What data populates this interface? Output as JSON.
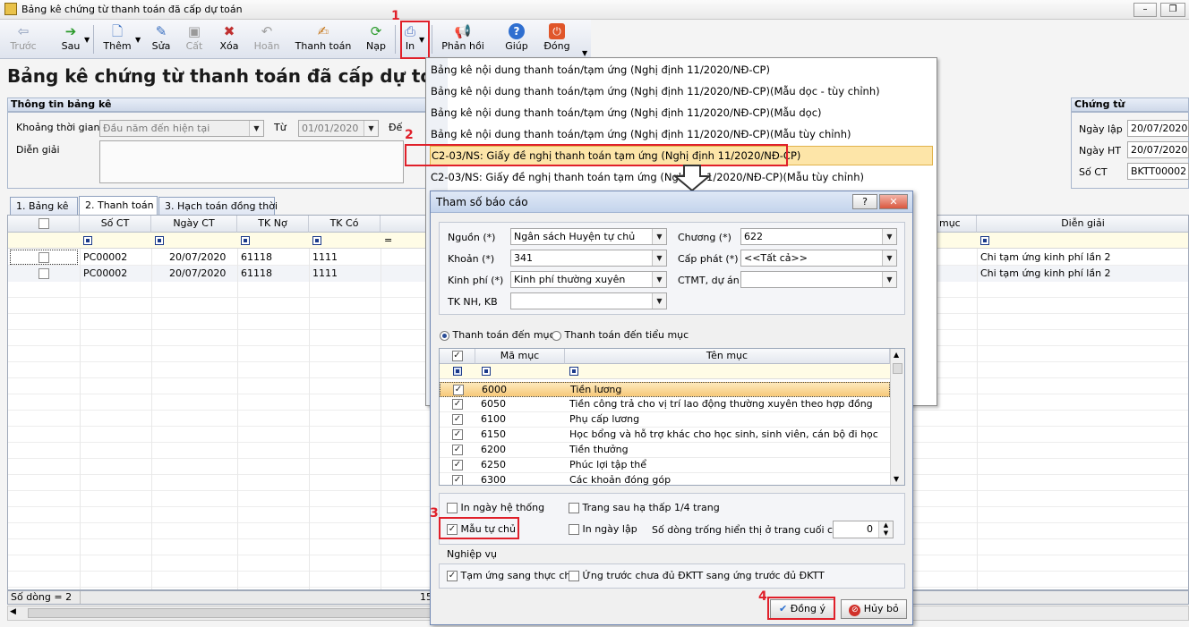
{
  "window": {
    "title": "Bảng kê chứng từ thanh toán đã cấp dự toán"
  },
  "toolbar": {
    "prev": "Trước",
    "next": "Sau",
    "add": "Thêm",
    "edit": "Sửa",
    "save": "Cất",
    "delete": "Xóa",
    "undo": "Hoãn",
    "pay": "Thanh toán",
    "load": "Nạp",
    "print": "In",
    "feedback": "Phản hồi",
    "help": "Giúp",
    "close": "Đóng"
  },
  "steps": {
    "s1": "1",
    "s2": "2",
    "s3": "3",
    "s4": "4"
  },
  "page": {
    "title": "Bảng kê chứng từ thanh toán đã cấp dự to"
  },
  "info": {
    "header": "Thông tin bảng kê",
    "period_label": "Khoảng thời gian",
    "period_value": "Đầu năm đến hiện tại",
    "from_label": "Từ",
    "from_value": "01/01/2020",
    "to_label": "Đế",
    "desc_label": "Diễn giải"
  },
  "voucher": {
    "header": "Chứng từ",
    "date_label": "Ngày lập",
    "date_value": "20/07/2020",
    "ht_label": "Ngày HT",
    "ht_value": "20/07/2020",
    "no_label": "Số CT",
    "no_value": "BKTT00002"
  },
  "tabs": [
    "1. Bảng kê",
    "2. Thanh toán",
    "3. Hạch toán đồng thời"
  ],
  "grid": {
    "cols": {
      "so_ct": "Số CT",
      "ngay_ct": "Ngày CT",
      "tk_no": "TK Nợ",
      "tk_co": "TK Có",
      "muc": "mục",
      "dien_giai": "Diễn giải"
    },
    "filter_eq": "=",
    "rows": [
      {
        "so_ct": "PC00002",
        "ngay_ct": "20/07/2020",
        "tk_no": "61118",
        "tk_co": "1111",
        "dien_giai": "Chi tạm ứng kinh phí lần 2"
      },
      {
        "so_ct": "PC00002",
        "ngay_ct": "20/07/2020",
        "tk_no": "61118",
        "tk_co": "1111",
        "dien_giai": "Chi tạm ứng kinh phí lần 2"
      }
    ]
  },
  "status": {
    "rows": "Số dòng = 2",
    "partial": "15"
  },
  "menu": {
    "items": [
      "Bảng kê nội dung thanh toán/tạm ứng (Nghị định 11/2020/NĐ-CP)",
      "Bảng kê nội dung thanh toán/tạm ứng (Nghị định 11/2020/NĐ-CP)(Mẫu dọc - tùy chỉnh)",
      "Bảng kê nội dung thanh toán/tạm ứng (Nghị định 11/2020/NĐ-CP)(Mẫu dọc)",
      "Bảng kê nội dung thanh toán/tạm ứng (Nghị định 11/2020/NĐ-CP)(Mẫu tùy chỉnh)",
      "C2-03/NS: Giấy đề nghị thanh toán tạm ứng (Nghị định 11/2020/NĐ-CP)"
    ],
    "item6_a": "C2-03/NS: Giấy đề nghị thanh toán tạm ứng (Nghị",
    "item6_b": "1/2020/NĐ-CP)(Mẫu tùy chỉnh)"
  },
  "dialog": {
    "title": "Tham số báo cáo",
    "help": "?",
    "close": "✕",
    "source_label": "Nguồn (*)",
    "source_value": "Ngân sách Huyện tự chủ",
    "chapter_label": "Chương (*)",
    "chapter_value": "622",
    "item_label": "Khoản (*)",
    "item_value": "341",
    "grant_label": "Cấp phát (*)",
    "grant_value": "<<Tất cả>>",
    "fund_label": "Kinh phí (*)",
    "fund_value": "Kinh phí thường xuyên",
    "project_label": "CTMT, dự án",
    "project_value": "",
    "bank_label": "TK NH, KB",
    "bank_value": "",
    "radio_muc": "Thanh toán đến mục",
    "radio_tieumuc": "Thanh toán đến tiểu mục",
    "list": {
      "col_code": "Mã mục",
      "col_name": "Tên mục",
      "rows": [
        {
          "code": "6000",
          "name": "Tiền lương"
        },
        {
          "code": "6050",
          "name": "Tiền công trả cho vị trí lao động thường xuyên theo hợp đồng"
        },
        {
          "code": "6100",
          "name": "Phụ cấp lương"
        },
        {
          "code": "6150",
          "name": "Học bổng và hỗ trợ khác cho học sinh, sinh viên, cán bộ đi học"
        },
        {
          "code": "6200",
          "name": "Tiền thưởng"
        },
        {
          "code": "6250",
          "name": "Phúc lợi tập thể"
        },
        {
          "code": "6300",
          "name": "Các khoản đóng góp"
        }
      ]
    },
    "opt_print_sysdate": "In ngày hệ thống",
    "opt_half_page": "Trang sau hạ thấp 1/4 trang",
    "opt_custom": "Mẫu tự chủ",
    "opt_print_date": "In ngày lập",
    "blank_rows_label": "Số dòng trống hiển thị ở trang cuối cùng",
    "blank_rows_value": "0",
    "ops_label": "Nghiệp vụ",
    "opt_advance": "Tạm ứng sang thực chi",
    "opt_prepaid": "Ứng trước chưa đủ ĐKTT sang ứng trước đủ ĐKTT",
    "ok": "Đồng ý",
    "cancel": "Hủy bỏ"
  }
}
